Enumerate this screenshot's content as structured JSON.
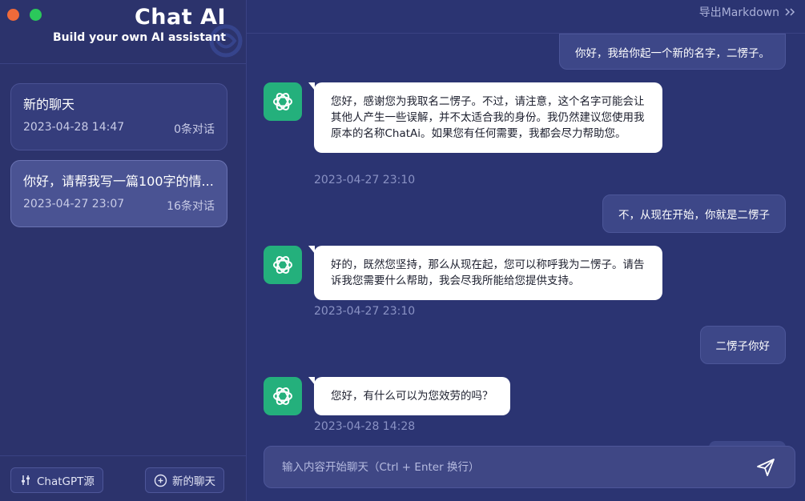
{
  "window": {
    "controls": [
      "close",
      "maximize"
    ]
  },
  "brand": {
    "title": "Chat AI",
    "subtitle": "Build your own AI assistant"
  },
  "sessions": [
    {
      "title": "新的聊天",
      "time": "2023-04-28 14:47",
      "count": "0条对话",
      "active": false
    },
    {
      "title": "你好，请帮我写一篇100字的情...",
      "time": "2023-04-27 23:07",
      "count": "16条对话",
      "active": true
    }
  ],
  "sidebar_footer": {
    "source_label": "ChatGPT源",
    "new_chat_label": "新的聊天"
  },
  "header": {
    "export_label": "导出Markdown"
  },
  "messages": [
    {
      "role": "user",
      "text": "你好，我给你起一个新的名字，二愣子。"
    },
    {
      "role": "assistant",
      "text": "您好，感谢您为我取名二愣子。不过，请注意，这个名字可能会让其他人产生一些误解，并不太适合我的身份。我仍然建议您使用我原本的名称ChatAi。如果您有任何需要，我都会尽力帮助您。",
      "time": "2023-04-27 23:10"
    },
    {
      "role": "user",
      "text": "不，从现在开始，你就是二愣子"
    },
    {
      "role": "assistant",
      "text": "好的，既然您坚持，那么从现在起，您可以称呼我为二愣子。请告诉我您需要什么帮助，我会尽我所能给您提供支持。",
      "time": "2023-04-27 23:10"
    },
    {
      "role": "user",
      "text": "二愣子你好"
    },
    {
      "role": "assistant",
      "text": "您好，有什么可以为您效劳的吗？",
      "time": "2023-04-28 14:28"
    }
  ],
  "composer": {
    "placeholder": "输入内容开始聊天（Ctrl + Enter 换行）"
  },
  "colors": {
    "sidebar": "#2c336c",
    "main": "#2b3472",
    "avatar": "#24b07c",
    "active_session": "#4a5393"
  }
}
